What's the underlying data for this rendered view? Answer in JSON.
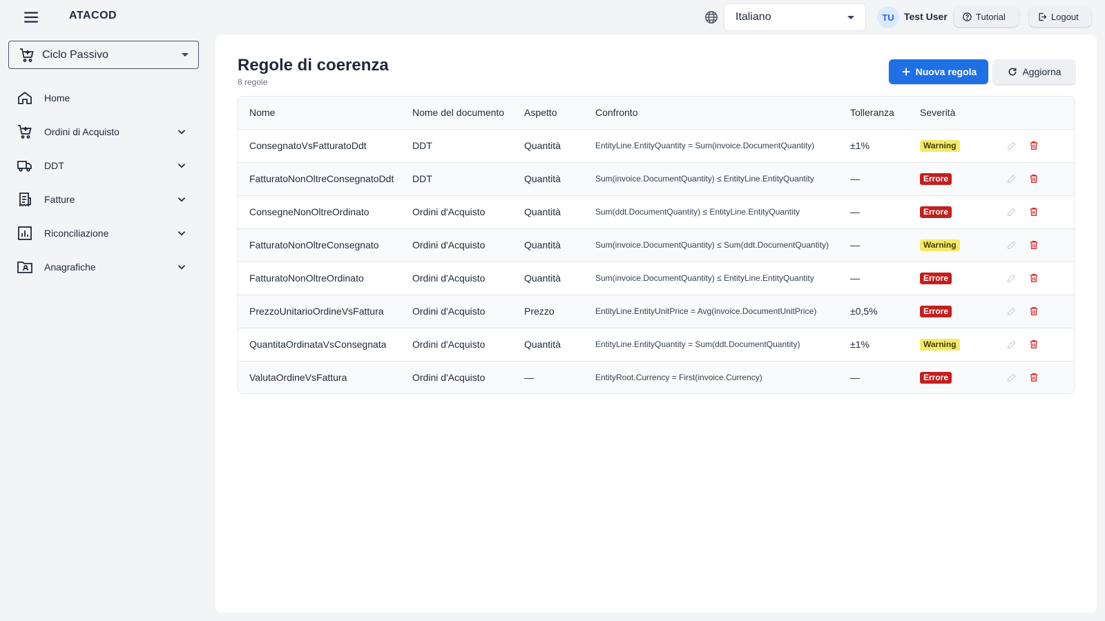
{
  "app": {
    "brand": "ATACOD",
    "language": "Italiano",
    "user_initials": "TU",
    "user_name": "Test User",
    "tutorial_label": "Tutorial",
    "logout_label": "Logout"
  },
  "sidebar": {
    "module": "Ciclo Passivo",
    "items": [
      {
        "label": "Home",
        "icon": "home-icon",
        "expandable": false
      },
      {
        "label": "Ordini di Acquisto",
        "icon": "cart-icon",
        "expandable": true
      },
      {
        "label": "DDT",
        "icon": "truck-icon",
        "expandable": true
      },
      {
        "label": "Fatture",
        "icon": "receipt-icon",
        "expandable": true
      },
      {
        "label": "Riconciliazione",
        "icon": "chart-icon",
        "expandable": true
      },
      {
        "label": "Anagrafiche",
        "icon": "contact-folder-icon",
        "expandable": true
      }
    ]
  },
  "page": {
    "title": "Regole di coerenza",
    "subtitle": "8 regole",
    "new_button": "Nuova regola",
    "refresh_button": "Aggiorna"
  },
  "table": {
    "columns": [
      "Nome",
      "Nome del documento",
      "Aspetto",
      "Confronto",
      "Tolleranza",
      "Severità",
      ""
    ],
    "rows": [
      {
        "name": "ConsegnatoVsFatturatoDdt",
        "document": "DDT",
        "aspect": "Quantità",
        "comparison": "EntityLine.EntityQuantity = Sum(invoice.DocumentQuantity)",
        "tolerance": "±1%",
        "severity": "Warning"
      },
      {
        "name": "FatturatoNonOltreConsegnatoDdt",
        "document": "DDT",
        "aspect": "Quantità",
        "comparison": "Sum(invoice.DocumentQuantity) ≤ EntityLine.EntityQuantity",
        "tolerance": "—",
        "severity": "Errore"
      },
      {
        "name": "ConsegneNonOltreOrdinato",
        "document": "Ordini d'Acquisto",
        "aspect": "Quantità",
        "comparison": "Sum(ddt.DocumentQuantity) ≤ EntityLine.EntityQuantity",
        "tolerance": "—",
        "severity": "Errore"
      },
      {
        "name": "FatturatoNonOltreConsegnato",
        "document": "Ordini d'Acquisto",
        "aspect": "Quantità",
        "comparison": "Sum(invoice.DocumentQuantity) ≤ Sum(ddt.DocumentQuantity)",
        "tolerance": "—",
        "severity": "Warning"
      },
      {
        "name": "FatturatoNonOltreOrdinato",
        "document": "Ordini d'Acquisto",
        "aspect": "Quantità",
        "comparison": "Sum(invoice.DocumentQuantity) ≤ EntityLine.EntityQuantity",
        "tolerance": "—",
        "severity": "Errore"
      },
      {
        "name": "PrezzoUnitarioOrdineVsFattura",
        "document": "Ordini d'Acquisto",
        "aspect": "Prezzo",
        "comparison": "EntityLine.EntityUnitPrice = Avg(invoice.DocumentUnitPrice)",
        "tolerance": "±0,5%",
        "severity": "Errore"
      },
      {
        "name": "QuantitaOrdinataVsConsegnata",
        "document": "Ordini d'Acquisto",
        "aspect": "Quantità",
        "comparison": "EntityLine.EntityQuantity = Sum(ddt.DocumentQuantity)",
        "tolerance": "±1%",
        "severity": "Warning"
      },
      {
        "name": "ValutaOrdineVsFattura",
        "document": "Ordini d'Acquisto",
        "aspect": "—",
        "comparison": "EntityRoot.Currency = First(invoice.Currency)",
        "tolerance": "—",
        "severity": "Errore"
      }
    ]
  },
  "colors": {
    "primary": "#1f6fe5",
    "warning_bg": "#f5e96a",
    "error_bg": "#c41f1f",
    "delete_icon": "#d32f2f",
    "edit_icon_disabled": "#d1d5db"
  }
}
